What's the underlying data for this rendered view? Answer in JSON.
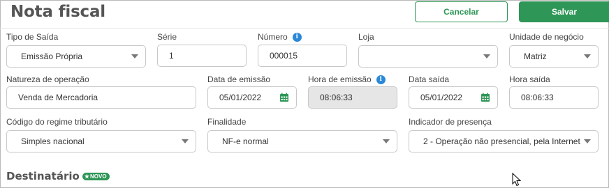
{
  "header": {
    "title": "Nota fiscal",
    "cancel_label": "Cancelar",
    "save_label": "Salvar"
  },
  "fields": {
    "tipo_saida": {
      "label": "Tipo de Saída",
      "value": "Emissão Própria"
    },
    "serie": {
      "label": "Série",
      "value": "1"
    },
    "numero": {
      "label": "Número",
      "value": "000015"
    },
    "loja": {
      "label": "Loja",
      "value": ""
    },
    "unidade_negocio": {
      "label": "Unidade de negócio",
      "value": "Matriz"
    },
    "natureza_operacao": {
      "label": "Natureza de operação",
      "value": "Venda de Mercadoria"
    },
    "data_emissao": {
      "label": "Data de emissão",
      "value": "05/01/2022"
    },
    "hora_emissao": {
      "label": "Hora de emissão",
      "value": "08:06:33"
    },
    "data_saida": {
      "label": "Data saída",
      "value": "05/01/2022"
    },
    "hora_saida": {
      "label": "Hora saída",
      "value": "08:06:33"
    },
    "regime_tributario": {
      "label": "Código do regime tributário",
      "value": "Simples nacional"
    },
    "finalidade": {
      "label": "Finalidade",
      "value": "NF-e normal"
    },
    "indicador_presenca": {
      "label": "Indicador de presença",
      "value": "2 - Operação não presencial, pela Internet"
    }
  },
  "section": {
    "title": "Destinatário",
    "badge": "NOVO"
  },
  "colors": {
    "accent": "#2e9656",
    "info": "#2a88d8",
    "disabled_bg": "#e6e6e6"
  }
}
